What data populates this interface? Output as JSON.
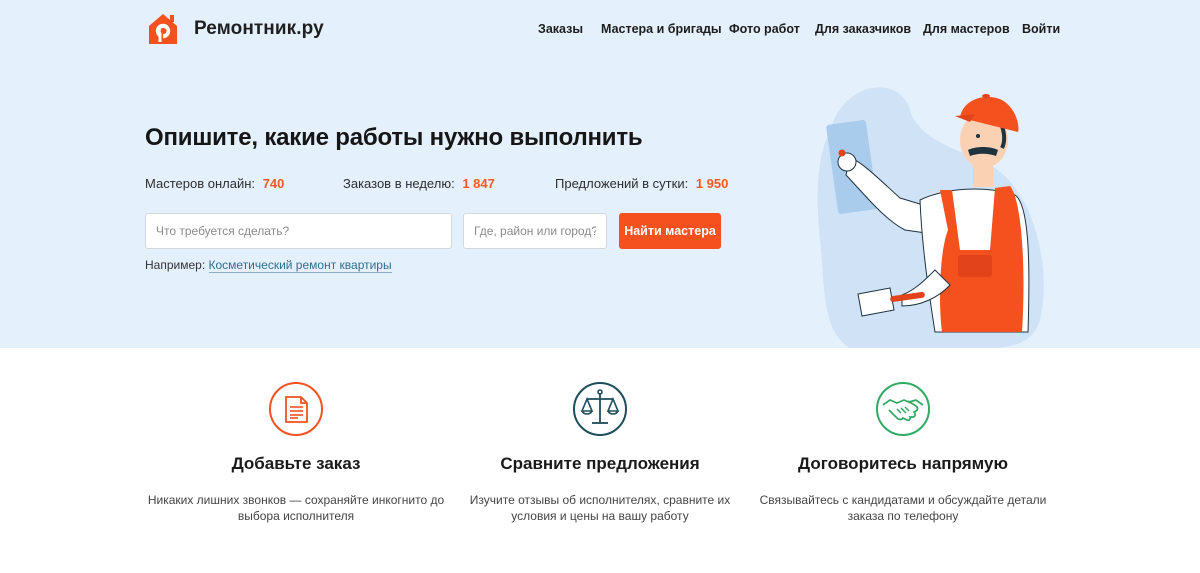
{
  "header": {
    "logo_text": "Ремонтник.ру",
    "logo_letter": "Р",
    "nav": [
      {
        "label": "Заказы"
      },
      {
        "label": "Мастера и бригады"
      },
      {
        "label": "Фото работ"
      },
      {
        "label": "Для заказчиков"
      },
      {
        "label": "Для мастеров"
      },
      {
        "label": "Войти"
      }
    ]
  },
  "hero": {
    "headline": "Опишите, какие работы нужно выполнить",
    "stats": [
      {
        "label": "Мастеров онлайн:",
        "value": "740"
      },
      {
        "label": "Заказов в неделю:",
        "value": "1 847"
      },
      {
        "label": "Предложений в сутки:",
        "value": "1 950"
      }
    ],
    "search": {
      "task_placeholder": "Что требуется сделать?",
      "task_value": "",
      "location_placeholder": "Где, район или город?",
      "location_value": "",
      "button_label": "Найти мастера"
    },
    "example": {
      "prefix": "Например:",
      "link": "Косметический ремонт квартиры"
    }
  },
  "features": [
    {
      "icon": "document-icon",
      "title": "Добавьте заказ",
      "desc": "Никаких лишних звонков — сохраняйте инкогнито до выбора исполнителя",
      "color": "#f4511e"
    },
    {
      "icon": "scales-icon",
      "title": "Сравните предложения",
      "desc": "Изучите отзывы об исполнителях, сравните их условия и цены на вашу работу",
      "color": "#1e4d5c"
    },
    {
      "icon": "handshake-icon",
      "title": "Договоритесь напрямую",
      "desc": "Связывайтесь с кандидатами и обсуждайте детали заказа по телефону",
      "color": "#2eaa62"
    }
  ],
  "colors": {
    "accent": "#f4511e",
    "hero_bg": "#e4f0fc",
    "number": "#f15a24"
  }
}
